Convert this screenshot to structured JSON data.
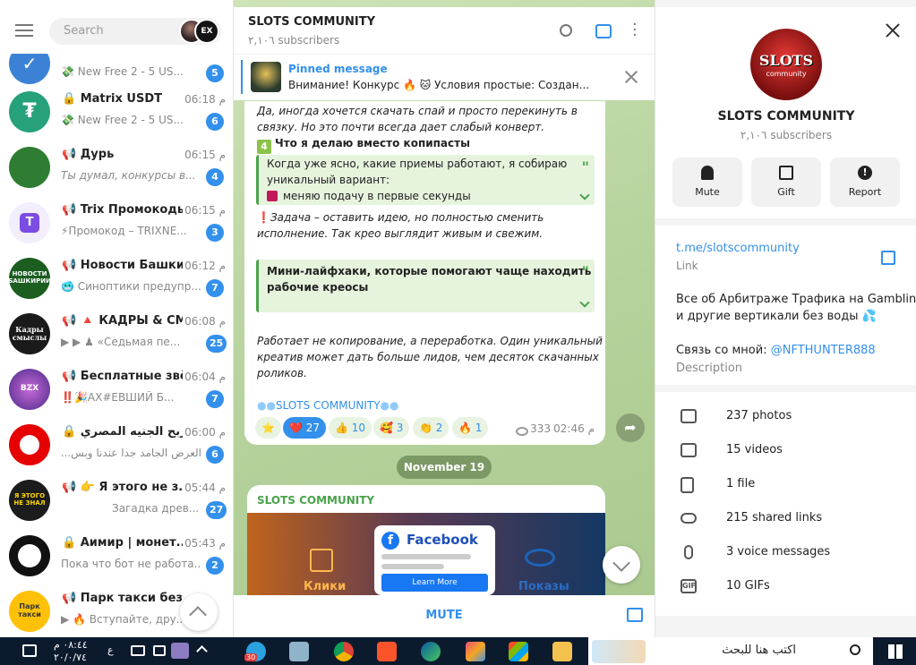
{
  "sidebar": {
    "search_placeholder": "Search",
    "chats": [
      {
        "title": "",
        "time": "",
        "preview": "💸 New Free 2 - 5 US...",
        "badge": "5"
      },
      {
        "title": "🔒 Matrix USDT",
        "time": "06:18 م",
        "preview": "💸 New Free 2 - 5 US...",
        "badge": "6"
      },
      {
        "title": "📢 Дурь",
        "time": "06:15 م",
        "preview": "Ты думал, конкурсы в...",
        "badge": "4"
      },
      {
        "title": "📢 Trix Промокоды",
        "time": "06:15 م",
        "preview": "⚡Промокод – TRIXNE...",
        "badge": "3"
      },
      {
        "title": "📢 Новости Башки...",
        "time": "06:12 م",
        "preview": "🥶 Синоптики предупр...",
        "badge": "7"
      },
      {
        "title": "📢 🔺 КАДРЫ & СМ...",
        "time": "06:08 م",
        "preview": "▶ ▶ ♟ «Седьмая пе...",
        "badge": "25"
      },
      {
        "title": "📢 Бесплатные звё...",
        "time": "06:04 م",
        "preview": "‼️🎉AX#ЕВШИЙ Б...",
        "badge": "7"
      },
      {
        "title": "🔒 ربح الجنيه المصري",
        "time": "06:00 م",
        "preview": "العرض الجامد جدا عندنا وبس...",
        "badge": "6"
      },
      {
        "title": "📢 👉 Я этого не з...",
        "time": "05:44 م",
        "preview": "Загадка древ...",
        "badge": "27"
      },
      {
        "title": "🔒 Аимир | монет...",
        "time": "05:43 م",
        "preview": "Пока что бот не работа...",
        "badge": "2"
      },
      {
        "title": "📢 Парк такси без ...",
        "time": "",
        "preview": "▶ 🔥 Вступайте, дру...",
        "badge": ""
      }
    ],
    "avatars": [
      "",
      "",
      "",
      "T",
      "НОВОСТИ БАШКИРИИ",
      "Кадры смыслы",
      "BZX",
      "",
      "Я ЭТОГО НЕ ЗНАЛ",
      "",
      "Парк такси"
    ]
  },
  "main": {
    "channel_title": "SLOTS COMMUNITY",
    "subscribers": "٢,١٠٦ subscribers",
    "pinned_title": "Pinned message",
    "pinned_text": "Внимание! Конкурс 🔥 🐱 Условия простые:  Создан...",
    "msg_lines": [
      "Да, иногда хочется скачать спай и просто перекинуть в",
      "связку. Но это почти всегда дает слабый конверт."
    ],
    "heading1": "Что я делаю вместо копипасты",
    "quote1": [
      "Когда уже ясно, какие приемы работают, я собираю",
      "уникальный вариант:",
      "меняю подачу в первые секунды"
    ],
    "task_lines": [
      "Задача – оставить идею, но полностью сменить",
      "исполнение. Так крео выглядит живым и свежим."
    ],
    "quote2": [
      "Мини-лайфхаки, которые помогают чаще находить",
      "рабочие креосы"
    ],
    "closing": [
      "Работает не копирование, а переработка. Один уникальный",
      "креатив может дать больше лидов, чем десяток скачанных",
      "роликов."
    ],
    "signature": "SLOTS COMMUNITY",
    "reactions": [
      {
        "emoji": "⭐",
        "count": ""
      },
      {
        "emoji": "❤️",
        "count": "27"
      },
      {
        "emoji": "👍",
        "count": "10"
      },
      {
        "emoji": "🥰",
        "count": "3"
      },
      {
        "emoji": "👏",
        "count": "2"
      },
      {
        "emoji": "🔥",
        "count": "1"
      }
    ],
    "views": "333",
    "time": "02:46 م",
    "date_divider": "November 19",
    "msg2_author": "SLOTS COMMUNITY",
    "promo_fb": "Facebook",
    "promo_learn": "Learn More",
    "promo_left": "Клики",
    "promo_right": "Показы",
    "mute_label": "MUTE"
  },
  "profile": {
    "title": "SLOTS COMMUNITY",
    "subscribers": "٢,١٠٦ subscribers",
    "avatar_line1": "SLOTS",
    "avatar_line2": "community",
    "actions": [
      {
        "label": "Mute"
      },
      {
        "label": "Gift"
      },
      {
        "label": "Report"
      }
    ],
    "link": "t.me/slotscommunity",
    "link_label": "Link",
    "desc_lines": [
      "Все об Арбитраже Трафика на Gambling",
      "и другие вертикали без воды 💦"
    ],
    "contact_prefix": "Связь со мной: ",
    "contact_handle": "@NFTHUNTER888",
    "desc_label": "Description",
    "media": [
      {
        "label": "237 photos",
        "icon": "photo-icon"
      },
      {
        "label": "15 videos",
        "icon": "video-icon"
      },
      {
        "label": "1 file",
        "icon": "file-icon"
      },
      {
        "label": "215 shared links",
        "icon": "link-icon"
      },
      {
        "label": "3 voice messages",
        "icon": "mic-icon"
      },
      {
        "label": "10 GIFs",
        "icon": "gif-icon"
      }
    ]
  },
  "taskbar": {
    "search_text": "اكتب هنا للبحث",
    "time": "٠٨:٤٤ م",
    "date": "٢٠/٠/٧٤",
    "lang": "ع",
    "telegram_badge": "30"
  }
}
